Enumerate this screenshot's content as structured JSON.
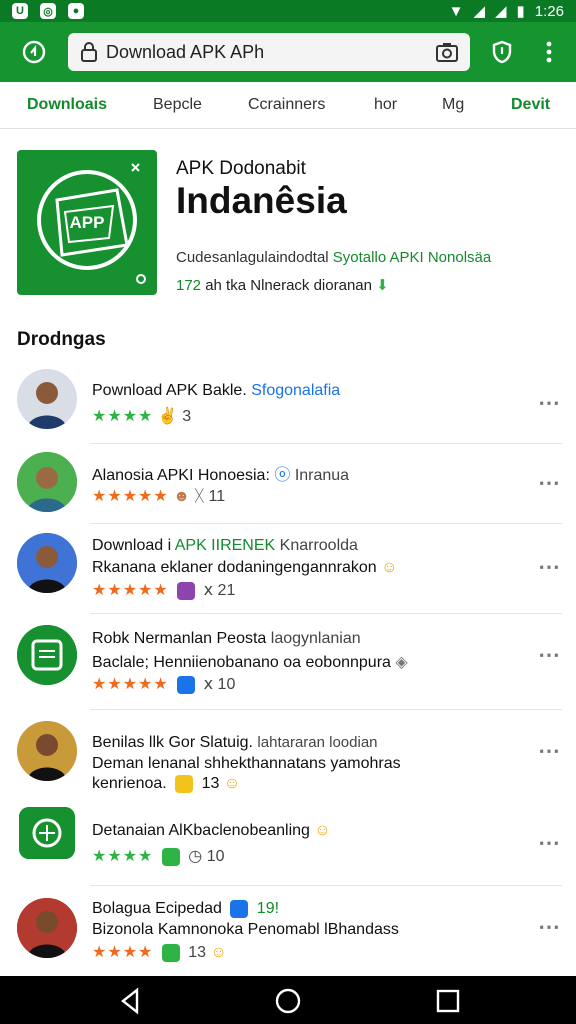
{
  "status_bar": {
    "time": "1:26"
  },
  "toolbar": {
    "url": "Download APK APh"
  },
  "tabs": [
    "Downloais",
    "Bepcle",
    "Ccrainners",
    "hor",
    "Mg",
    "Devit"
  ],
  "hero": {
    "icon_text": "APP",
    "subtitle": "APK Dodonabit",
    "title": "Indanêsia",
    "desc_plain": "Cudesanlagulaindodtal",
    "desc_accent": "Syotallo APKI Nonolsäa",
    "stats_num": "172",
    "stats_text": "ah tka Nlnerack dioranan"
  },
  "section_title": "Drodngas",
  "rows": [
    {
      "title": "Pownload APK Bakle.",
      "title_accent": "Sfogonalafia",
      "stars": "★★★★",
      "meta": "3"
    },
    {
      "title": "Alanosia APKI Honoesia:",
      "title_accent": "Inranua",
      "stars": "★★★★★",
      "meta": "11"
    },
    {
      "title": "Download i",
      "title_accent": "APK IIRENEK",
      "title_rest": "Knarroolda",
      "line2": "Rkanana eklaner dodaningengannrakon",
      "stars": "★★★★★",
      "meta": "21"
    },
    {
      "title": "Robk Nermanlan Peosta",
      "title_accent": "laogynlanian",
      "line2": "Baclale; Henniienobanano oa eobonnpura",
      "stars": "★★★★★",
      "meta": "10"
    },
    {
      "title": "Benilas llk Gor Slatuig.",
      "title_accent": "lahtararan loodian",
      "line2": "Deman lenanal shhekthannatans yamohras",
      "line3": "kenrienoa.",
      "meta": "13"
    },
    {
      "title": "Detanaian AlKbaclenobeanling",
      "stars": "★★★★",
      "meta": "10"
    },
    {
      "title": "Bolagua Ecipedad",
      "title_accent": "19!",
      "line2": "Bizonola Kamnonoka Penomabl lBhandass",
      "stars": "★★★★",
      "meta": "13"
    }
  ],
  "colors": {
    "brand_green": "#16942f",
    "accent_text": "#138a2c",
    "star_green": "#2fb344",
    "star_orange": "#f06a1d"
  }
}
